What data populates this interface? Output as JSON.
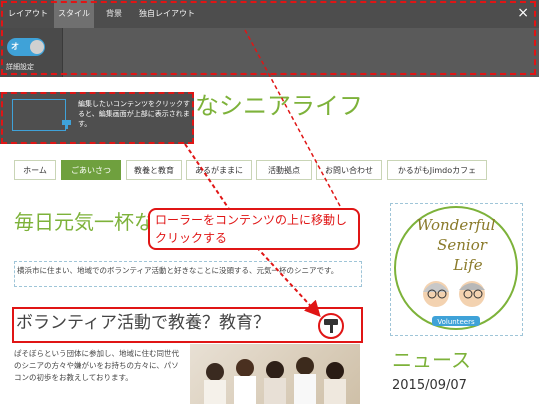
{
  "panel": {
    "tabs": [
      {
        "label": "レイアウト"
      },
      {
        "label": "スタイル"
      },
      {
        "label": "背景"
      },
      {
        "label": "独自レイアウト"
      }
    ],
    "active_tab": "スタイル",
    "close_glyph": "×",
    "toggle_state": "オ",
    "detail_label": "詳細設定"
  },
  "tooltip": {
    "text": "編集したいコンテンツをクリックすると、編集画面が上部に表示されます。"
  },
  "site": {
    "title": "なシニアライフ",
    "nav": [
      {
        "label": "ホーム"
      },
      {
        "label": "ごあいさつ"
      },
      {
        "label": "教養と教育"
      },
      {
        "label": "あるがままに"
      },
      {
        "label": "活動拠点"
      },
      {
        "label": "お問い合わせ"
      },
      {
        "label": "かるがもJimdoカフェ"
      }
    ],
    "active_nav": "ごあいさつ",
    "heading1": "毎日元気一杯な",
    "paragraph1": "横浜市に住まい、地域でのボランティア活動と好きなことに没頭する、元気一杯のシニアです。",
    "heading2": "ボランティア活動で教養？教育？",
    "paragraph2": "ぱそぼらという団体に参加し、地域に住む同世代のシニアの方々や嫌がいをお持ちの方々に、パソコンの初歩をお教えしております。",
    "sidebar": {
      "logo_lines": [
        "Wonderful",
        "Senior",
        "Life"
      ],
      "logo_badge": "Volunteers",
      "news_title": "ニュース",
      "news_date": "2015/09/07"
    }
  },
  "annotation": {
    "callout_text": "ローラーをコンテンツの上に移動しクリックする",
    "accent_color": "#e01515"
  },
  "colors": {
    "panel_bg": "#5a5a5a",
    "brand_green": "#7db23a",
    "toggle_blue": "#3fa2d8"
  }
}
